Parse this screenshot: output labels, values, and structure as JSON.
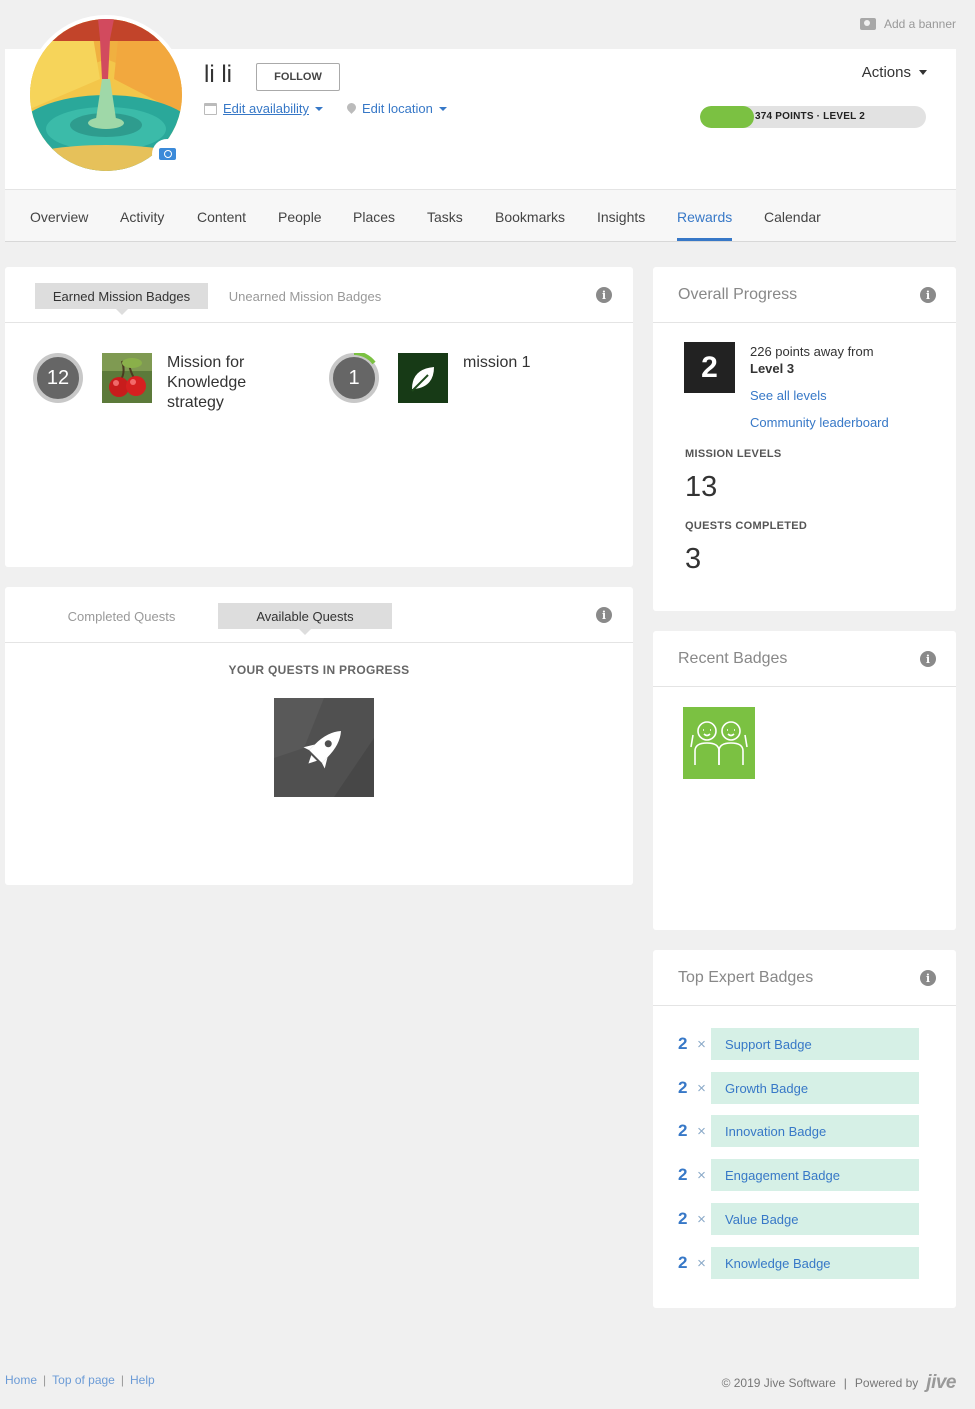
{
  "banner": {
    "add_banner_label": "Add a banner"
  },
  "profile": {
    "name": "li li",
    "follow_label": "FOLLOW",
    "edit_availability_label": "Edit availability",
    "edit_location_label": "Edit location",
    "actions_label": "Actions",
    "points_text": "374 POINTS · LEVEL 2",
    "points_fraction": 0.24
  },
  "nav": {
    "tabs": [
      {
        "label": "Overview"
      },
      {
        "label": "Activity"
      },
      {
        "label": "Content"
      },
      {
        "label": "People"
      },
      {
        "label": "Places"
      },
      {
        "label": "Tasks"
      },
      {
        "label": "Bookmarks"
      },
      {
        "label": "Insights"
      },
      {
        "label": "Rewards"
      },
      {
        "label": "Calendar"
      }
    ],
    "active": "Rewards"
  },
  "mission_badges": {
    "tab_earned": "Earned Mission Badges",
    "tab_unearned": "Unearned Mission Badges",
    "items": [
      {
        "count": "12",
        "title": "Mission for Knowledge strategy",
        "image_icon": "cherry-icon"
      },
      {
        "count": "1",
        "title": "mission 1",
        "image_icon": "leaf-icon"
      }
    ]
  },
  "quests": {
    "tab_completed": "Completed Quests",
    "tab_available": "Available Quests",
    "in_progress_heading": "YOUR QUESTS IN PROGRESS",
    "quest_icon": "rocket-icon"
  },
  "overall_progress": {
    "title": "Overall Progress",
    "level_number": "2",
    "points_away_text": "226 points away from",
    "next_level": "Level 3",
    "see_all_levels": "See all levels",
    "leaderboard": "Community leaderboard",
    "mission_levels_label": "MISSION LEVELS",
    "mission_levels_value": "13",
    "quests_completed_label": "QUESTS COMPLETED",
    "quests_completed_value": "3"
  },
  "recent_badges": {
    "title": "Recent Badges",
    "badge_icon": "two-people-icon"
  },
  "top_expert_badges": {
    "title": "Top Expert Badges",
    "items": [
      {
        "count": "2",
        "x": "×",
        "label": "Support Badge"
      },
      {
        "count": "2",
        "x": "×",
        "label": "Growth Badge"
      },
      {
        "count": "2",
        "x": "×",
        "label": "Innovation Badge"
      },
      {
        "count": "2",
        "x": "×",
        "label": "Engagement Badge"
      },
      {
        "count": "2",
        "x": "×",
        "label": "Value Badge"
      },
      {
        "count": "2",
        "x": "×",
        "label": "Knowledge Badge"
      }
    ]
  },
  "footer": {
    "home": "Home",
    "sep1": "|",
    "top_of_page": "Top of page",
    "sep2": "|",
    "help": "Help",
    "copyright": "© 2019 Jive Software",
    "sep3": "|",
    "powered_by": "Powered by",
    "logo_text": "jive"
  },
  "colors": {
    "accent": "#3778c7",
    "points_green": "#7bc142",
    "expert_tag_bg": "#d6f0e6",
    "recent_badge_bg": "#7bc142"
  }
}
